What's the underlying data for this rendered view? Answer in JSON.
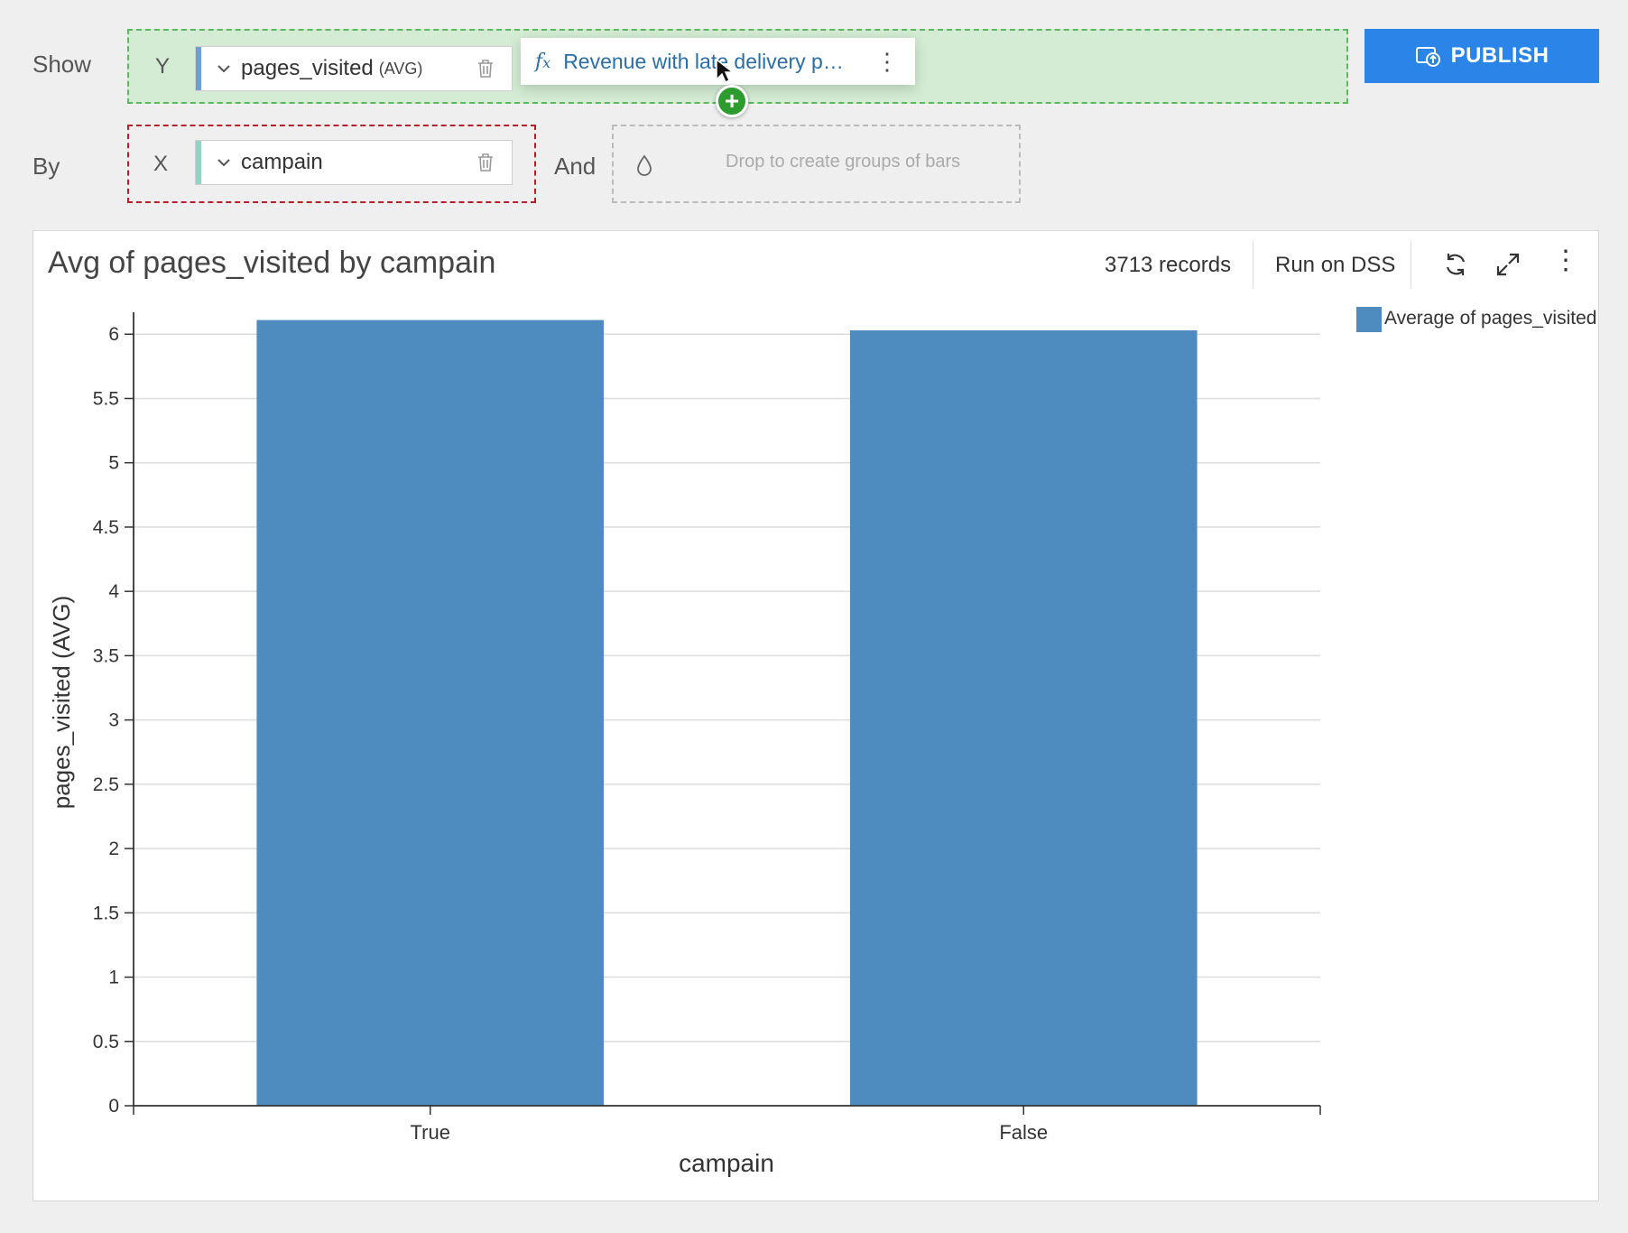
{
  "builder": {
    "show_label": "Show",
    "by_label": "By",
    "and_label": "And",
    "y_axis_letter": "Y",
    "x_axis_letter": "X",
    "y_field": "pages_visited",
    "y_agg": "(AVG)",
    "x_field": "campain",
    "dragging_field": "Revenue with late delivery p…",
    "group_drop_hint": "Drop to create groups of bars",
    "publish_label": "PUBLISH"
  },
  "chart_panel": {
    "title": "Avg of pages_visited by campain",
    "records": "3713 records",
    "run_label": "Run on DSS"
  },
  "colors": {
    "bar": "#4e8bbf",
    "publish": "#2b84e8",
    "drop_ok": "#5cb85c",
    "drop_required": "#b5202c"
  },
  "icons": [
    "chevron-down-icon",
    "trash-icon",
    "fx-icon",
    "more-vert-icon",
    "plus-icon",
    "publish-icon",
    "droplet-icon",
    "refresh-icon",
    "expand-icon",
    "cursor-icon"
  ],
  "chart_data": {
    "type": "bar",
    "categories": [
      "True",
      "False"
    ],
    "series": [
      {
        "name": "Average of pages_visited",
        "values": [
          6.11,
          6.03
        ]
      }
    ],
    "title": "Avg of pages_visited by campain",
    "xlabel": "campain",
    "ylabel": "pages_visited (AVG)",
    "ylim": [
      0,
      6.1
    ],
    "yticks": [
      0,
      0.5,
      1,
      1.5,
      2,
      2.5,
      3,
      3.5,
      4,
      4.5,
      5,
      5.5,
      6
    ],
    "grid": true,
    "legend": "top-right"
  }
}
